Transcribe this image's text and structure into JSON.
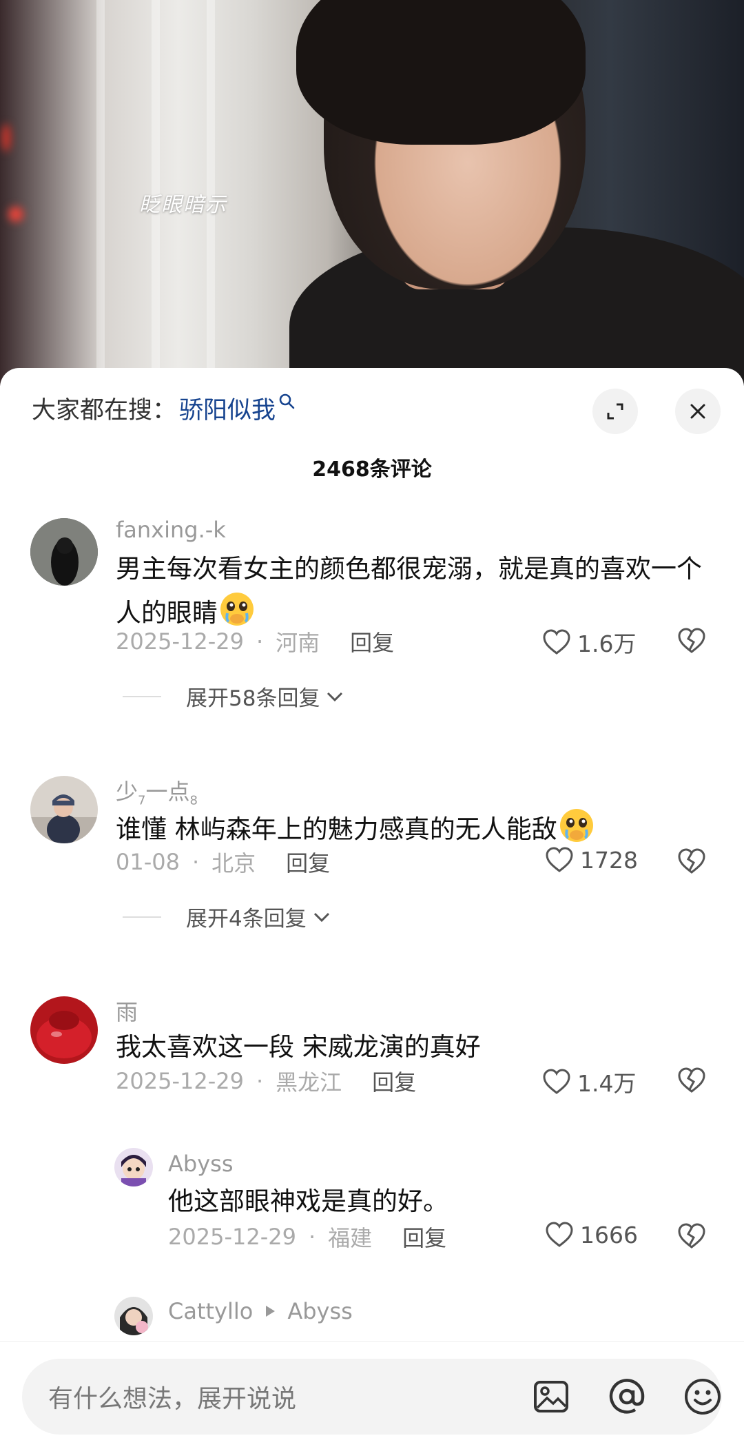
{
  "video": {
    "caption": "眨眼暗示"
  },
  "search_bar": {
    "prefix": "大家都在搜：",
    "term": "骄阳似我"
  },
  "comments_header": {
    "count_title": "2468条评论"
  },
  "comments": [
    {
      "username": "fanxing.-k",
      "text": "男主每次看女主的颜色都很宠溺，就是真的喜欢一个人的眼睛",
      "emoji": "pleading-face-covering-mouth",
      "date": "2025-12-29",
      "location": "河南",
      "reply_label": "回复",
      "likes": "1.6万",
      "expand_label": "展开58条回复"
    },
    {
      "username_main": "少",
      "username_sub1": "7",
      "username_mid": "一点",
      "username_sub2": "8",
      "text": "谁懂 林屿森年上的魅力感真的无人能敌",
      "emoji": "pleading-face-covering-mouth",
      "date": "01-08",
      "location": "北京",
      "reply_label": "回复",
      "likes": "1728",
      "expand_label": "展开4条回复"
    },
    {
      "username": "雨",
      "text": "我太喜欢这一段  宋威龙演的真好",
      "date": "2025-12-29",
      "location": "黑龙江",
      "reply_label": "回复",
      "likes": "1.4万"
    }
  ],
  "replies": [
    {
      "username": "Abyss",
      "text": "他这部眼神戏是真的好。",
      "date": "2025-12-29",
      "location": "福建",
      "reply_label": "回复",
      "likes": "1666"
    },
    {
      "username": "Cattyllo",
      "reply_to": "Abyss"
    }
  ],
  "input_bar": {
    "placeholder": "有什么想法，展开说说"
  },
  "colors": {
    "search_term": "#17448f",
    "meta_gray": "#aaaaaa",
    "text": "#111111"
  }
}
